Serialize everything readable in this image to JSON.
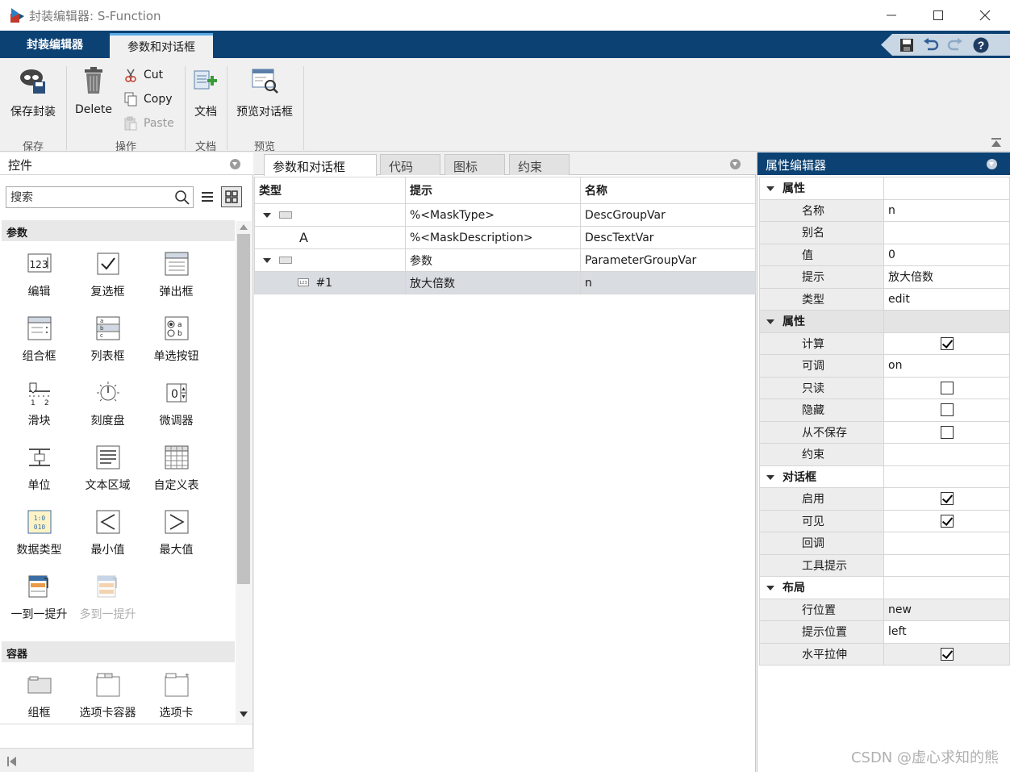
{
  "window": {
    "title": "封装编辑器: S-Function"
  },
  "ribbon_tabs": [
    {
      "label": "封装编辑器"
    },
    {
      "label": "参数和对话框"
    }
  ],
  "ribbon": {
    "save_mask": "保存封装",
    "delete": "Delete",
    "cut": "Cut",
    "copy": "Copy",
    "paste": "Paste",
    "doc": "文档",
    "preview": "预览对话框",
    "groups": {
      "save": "保存",
      "ops": "操作",
      "doc": "文档",
      "preview": "预览"
    }
  },
  "controls_panel": {
    "title": "控件",
    "search_placeholder": "搜索",
    "sections": {
      "params": "参数",
      "containers": "容器"
    },
    "params_items": [
      {
        "label": "编辑"
      },
      {
        "label": "复选框"
      },
      {
        "label": "弹出框"
      },
      {
        "label": "组合框"
      },
      {
        "label": "列表框"
      },
      {
        "label": "单选按钮"
      },
      {
        "label": "滑块"
      },
      {
        "label": "刻度盘"
      },
      {
        "label": "微调器"
      },
      {
        "label": "单位"
      },
      {
        "label": "文本区域"
      },
      {
        "label": "自定义表"
      },
      {
        "label": "数据类型"
      },
      {
        "label": "最小值"
      },
      {
        "label": "最大值"
      },
      {
        "label": "一到一提升"
      },
      {
        "label": "多到一提升"
      }
    ],
    "container_items": [
      {
        "label": "组框"
      },
      {
        "label": "选项卡容器"
      },
      {
        "label": "选项卡"
      }
    ]
  },
  "dialog_tabs": [
    {
      "label": "参数和对话框"
    },
    {
      "label": "代码"
    },
    {
      "label": "图标"
    },
    {
      "label": "约束"
    }
  ],
  "dialog_table": {
    "headers": {
      "type": "类型",
      "prompt": "提示",
      "name": "名称"
    },
    "rows": [
      {
        "type_text": "",
        "prompt": "%<MaskType>",
        "name": "DescGroupVar"
      },
      {
        "type_text": "A",
        "prompt": "%<MaskDescription>",
        "name": "DescTextVar"
      },
      {
        "type_text": "",
        "prompt": "参数",
        "name": "ParameterGroupVar"
      },
      {
        "type_text": "#1",
        "prompt": "放大倍数",
        "name": "n"
      }
    ]
  },
  "property_editor": {
    "title": "属性编辑器",
    "groups": [
      {
        "label": "属性",
        "rows": [
          {
            "key": "名称",
            "value": "n"
          },
          {
            "key": "别名",
            "value": ""
          },
          {
            "key": "值",
            "value": "0"
          },
          {
            "key": "提示",
            "value": "放大倍数"
          },
          {
            "key": "类型",
            "value": "edit"
          }
        ]
      },
      {
        "label": "属性",
        "rows": [
          {
            "key": "计算",
            "checked": true
          },
          {
            "key": "可调",
            "value": "on"
          },
          {
            "key": "只读",
            "checked": false
          },
          {
            "key": "隐藏",
            "checked": false
          },
          {
            "key": "从不保存",
            "checked": false
          },
          {
            "key": "约束",
            "value": ""
          }
        ]
      },
      {
        "label": "对话框",
        "rows": [
          {
            "key": "启用",
            "checked": true
          },
          {
            "key": "可见",
            "checked": true
          },
          {
            "key": "回调",
            "value": ""
          },
          {
            "key": "工具提示",
            "value": ""
          }
        ]
      },
      {
        "label": "布局",
        "rows": [
          {
            "key": "行位置",
            "value": "new"
          },
          {
            "key": "提示位置",
            "value": "left"
          },
          {
            "key": "水平拉伸",
            "checked": true
          }
        ]
      }
    ]
  },
  "watermark": "CSDN @虚心求知的熊"
}
